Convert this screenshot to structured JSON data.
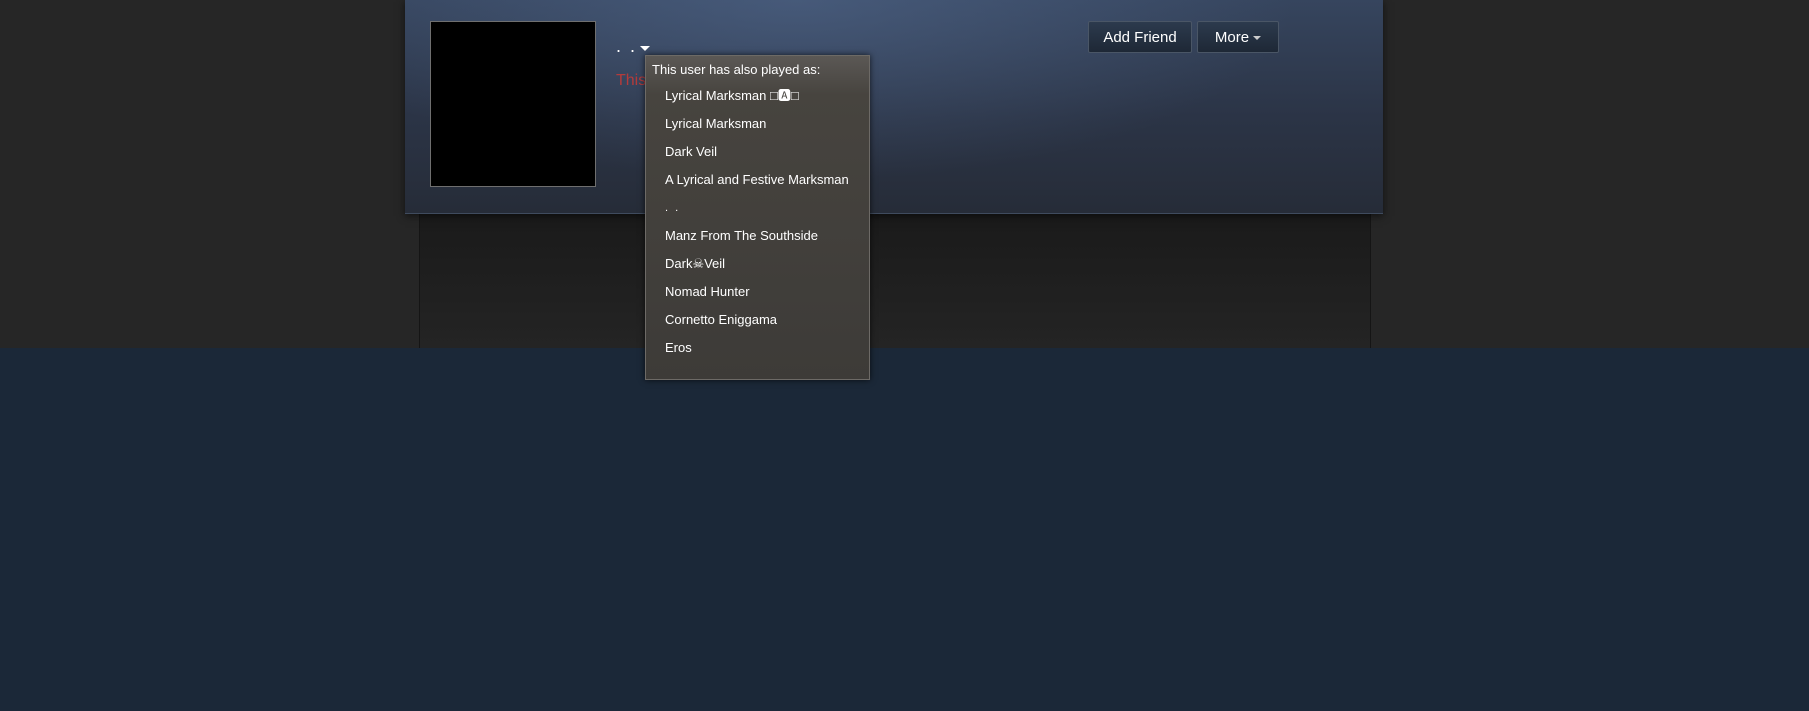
{
  "profile": {
    "persona_name": ". .",
    "private_notice": "This",
    "caret_icon": "caret-down-icon"
  },
  "actions": {
    "add_friend_label": "Add Friend",
    "more_label": "More"
  },
  "alias_popup": {
    "header": "This user has also played as:",
    "aliases": [
      "Lyrical Marksman □🅰□",
      "Lyrical Marksman",
      "Dark Veil",
      "A Lyrical and Festive Marksman",
      ". .",
      "Manz From The Southside",
      "Dark☠Veil",
      "Nomad Hunter",
      "Cornetto Eniggama",
      "Eros"
    ]
  },
  "colors": {
    "page_background": "#1b2838",
    "top_band": "#262626",
    "private_text": "#b33b3b",
    "popup_background": "#3d3b38"
  }
}
